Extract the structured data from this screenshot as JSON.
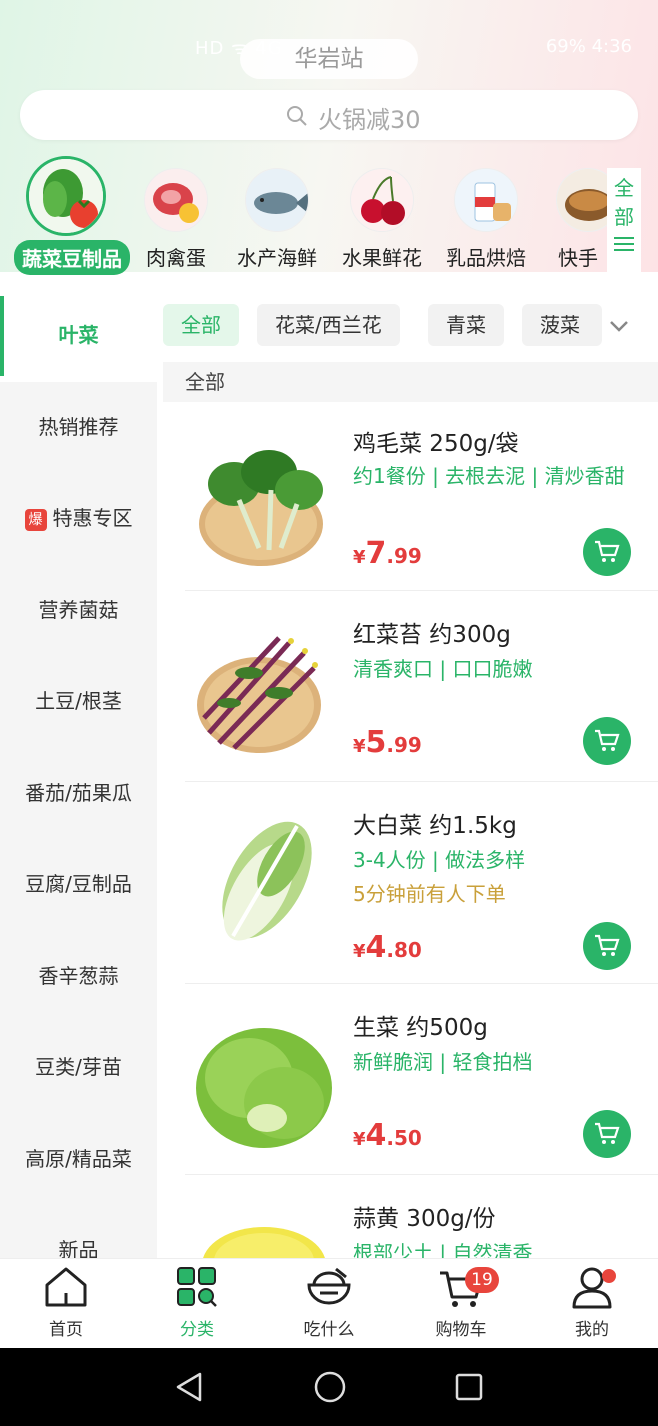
{
  "status_bar": {
    "left_text": "HD ᯤ 4G",
    "right_text": "69%  4:36"
  },
  "header": {
    "station": "华岩站",
    "search_placeholder": "火锅减30"
  },
  "categories": [
    {
      "label": "蔬菜豆制品",
      "icon": "vegetable-icon"
    },
    {
      "label": "肉禽蛋",
      "icon": "meat-icon"
    },
    {
      "label": "水产海鲜",
      "icon": "fish-icon"
    },
    {
      "label": "水果鲜花",
      "icon": "cherry-icon"
    },
    {
      "label": "乳品烘焙",
      "icon": "milk-icon"
    },
    {
      "label": "快手",
      "icon": "pot-icon"
    }
  ],
  "all_categories": {
    "line1": "全",
    "line2": "部"
  },
  "sidebar": [
    "叶菜",
    "热销推荐",
    "特惠专区",
    "营养菌菇",
    "土豆/根茎",
    "番茄/茄果瓜",
    "豆腐/豆制品",
    "香辛葱蒜",
    "豆类/芽苗",
    "高原/精品菜",
    "新品"
  ],
  "sidebar_badge": "爆",
  "chips": [
    "全部",
    "花菜/西兰花",
    "青菜",
    "菠菜"
  ],
  "section_header": "全部",
  "currency": "¥",
  "products": [
    {
      "name": "鸡毛菜 250g/袋",
      "desc": "约1餐份 | 去根去泥 | 清炒香甜",
      "price_int": "7",
      "price_dec": ".99",
      "image": "leafy-greens-image"
    },
    {
      "name": "红菜苔 约300g",
      "desc": "清香爽口 | 口口脆嫩",
      "price_int": "5",
      "price_dec": ".99",
      "image": "red-stem-greens-image"
    },
    {
      "name": "大白菜 约1.5kg",
      "desc": "3-4人份 | 做法多样",
      "order_note": "5分钟前有人下单",
      "price_int": "4",
      "price_dec": ".80",
      "image": "napa-cabbage-image"
    },
    {
      "name": "生菜 约500g",
      "desc": "新鲜脆润 | 轻食拍档",
      "price_int": "4",
      "price_dec": ".50",
      "image": "lettuce-image"
    },
    {
      "name": "蒜黄 300g/份",
      "desc": "根部少土 | 自然清香",
      "image": "garlic-chives-image"
    }
  ],
  "tabs": [
    {
      "label": "首页",
      "icon": "home-icon"
    },
    {
      "label": "分类",
      "icon": "category-icon"
    },
    {
      "label": "吃什么",
      "icon": "bowl-icon"
    },
    {
      "label": "购物车",
      "icon": "cart-icon"
    },
    {
      "label": "我的",
      "icon": "profile-icon"
    }
  ],
  "cart_badge": "19",
  "colors": {
    "accent": "#2ab468",
    "price": "#e33c3c",
    "badge": "#e8453c"
  }
}
